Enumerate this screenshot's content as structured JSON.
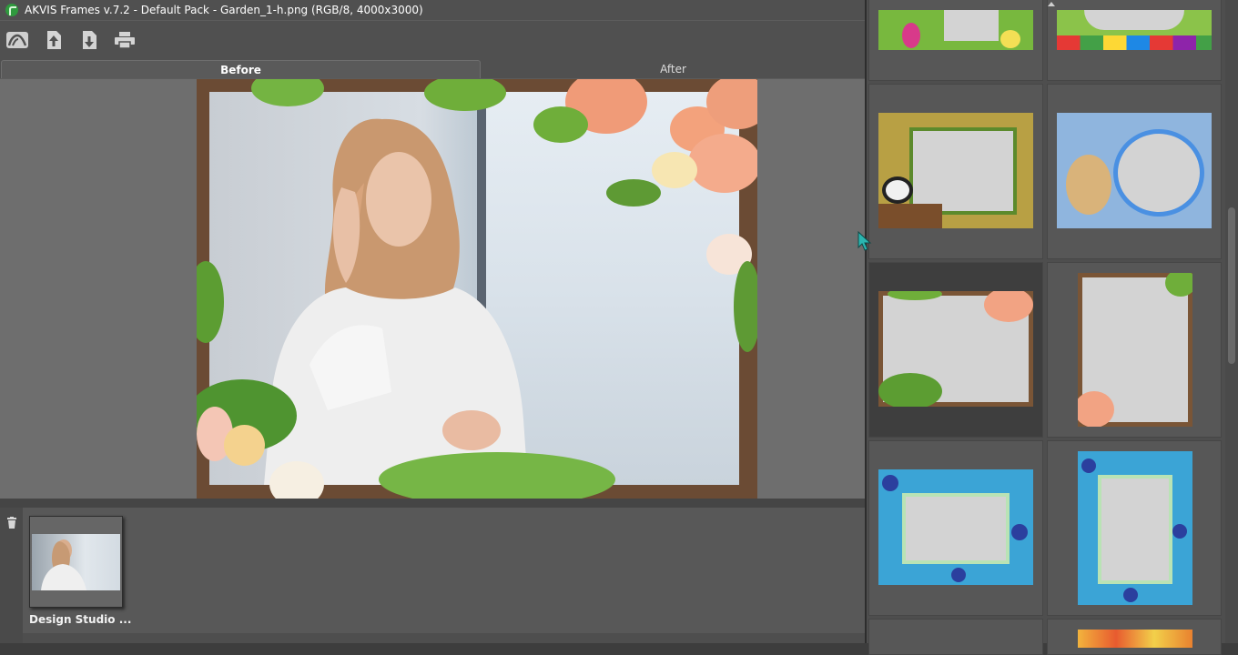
{
  "window": {
    "title": "AKVIS Frames v.7.2 - Default Pack - Garden_1-h.png (RGB/8, 4000x3000)"
  },
  "toolbar": {
    "buttons": [
      {
        "name": "home-button",
        "icon": "akvis-home-icon"
      },
      {
        "name": "open-button",
        "icon": "upload-icon"
      },
      {
        "name": "save-button",
        "icon": "download-icon"
      },
      {
        "name": "print-button",
        "icon": "printer-icon"
      }
    ]
  },
  "tabs": {
    "before": "Before",
    "after": "After",
    "active": "Before"
  },
  "bottom": {
    "thumbnail_label": "Design Studio ...",
    "trash_icon": "trash-icon"
  },
  "library": {
    "selected_index": 4,
    "frames": [
      {
        "theme": "easter-eggs"
      },
      {
        "theme": "gift-boxes-balloons"
      },
      {
        "theme": "bamboo-panda"
      },
      {
        "theme": "teddy-bear-patchwork"
      },
      {
        "theme": "garden-roses-horizontal"
      },
      {
        "theme": "garden-roses-vertical"
      },
      {
        "theme": "blueberries-horizontal"
      },
      {
        "theme": "blueberries-vertical"
      },
      {
        "theme": "fruit"
      }
    ]
  },
  "colors": {
    "background": "#3d3d3d",
    "panel": "#505050",
    "canvas": "#6e6e6e",
    "selected_cell": "#3e3e3e",
    "accent_cursor": "#2bb5b0"
  }
}
